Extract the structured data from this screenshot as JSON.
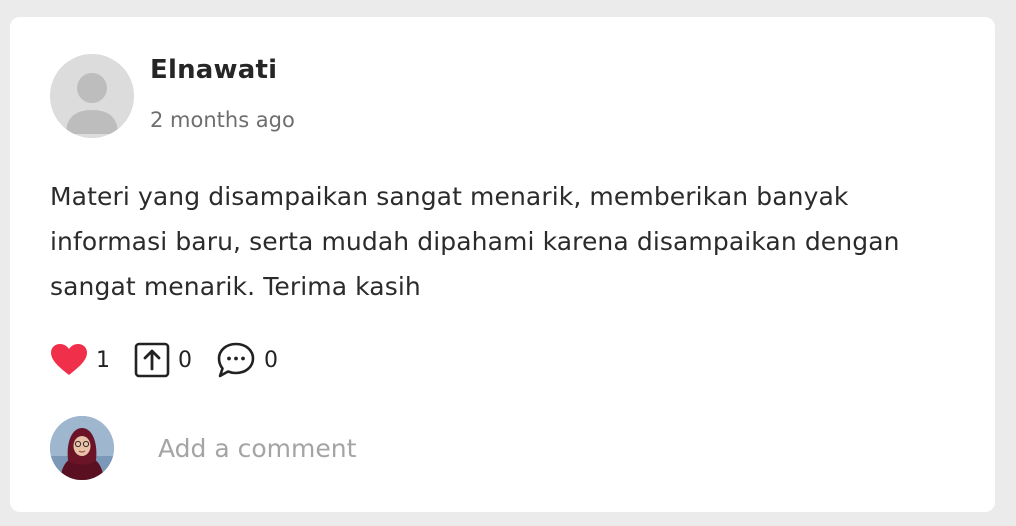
{
  "comment": {
    "author": "Elnawati",
    "timestamp": "2 months ago",
    "text": "Materi yang disampaikan sangat menarik, memberikan banyak informasi baru, serta mudah dipahami karena disampaikan dengan sangat menarik. Terima kasih",
    "avatar_icon": "default-user-avatar"
  },
  "actions": {
    "likes": {
      "icon": "heart-icon",
      "count": "1",
      "color": "#f0304a"
    },
    "shares": {
      "icon": "share-up-arrow-icon",
      "count": "0"
    },
    "replies": {
      "icon": "speech-bubble-icon",
      "count": "0"
    }
  },
  "reply": {
    "placeholder": "Add a comment",
    "avatar_icon": "current-user-avatar"
  }
}
